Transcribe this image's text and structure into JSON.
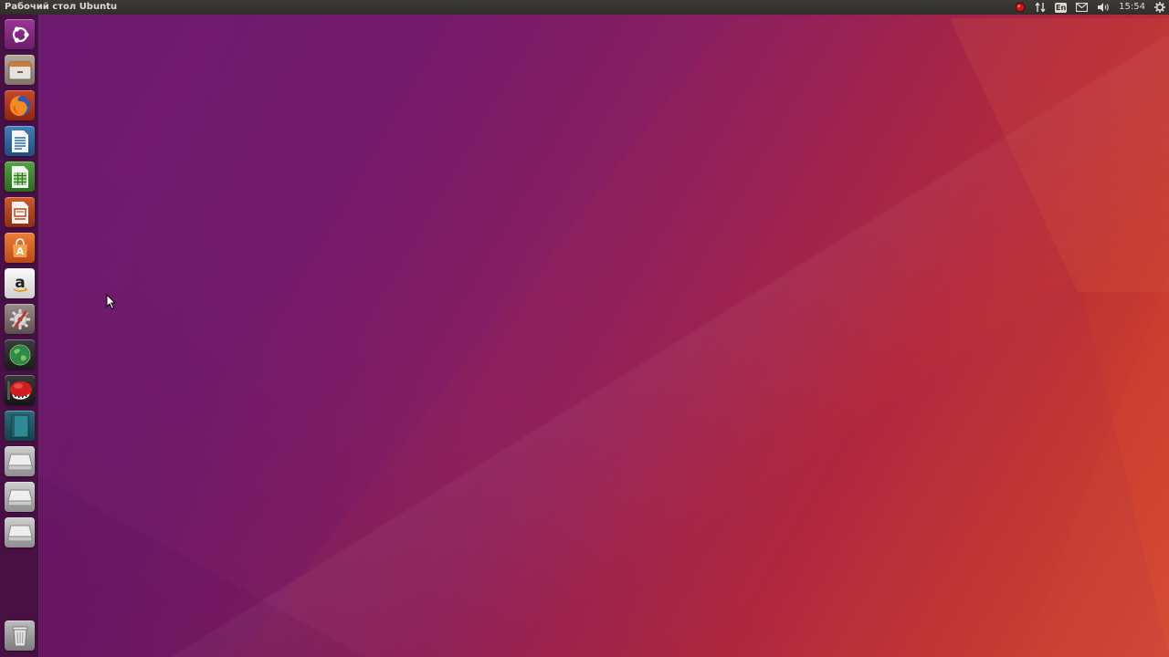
{
  "top_panel": {
    "title": "Рабочий стол Ubuntu",
    "keyboard_layout": "En",
    "clock": "15:54"
  },
  "launcher": {
    "items": [
      {
        "name": "dash-home",
        "icon": "ubuntu-logo-icon",
        "color": "#8e2a8a"
      },
      {
        "name": "files",
        "icon": "file-cabinet-icon",
        "color": "#9b8a7a"
      },
      {
        "name": "firefox",
        "icon": "firefox-icon",
        "color": "#b93a1f"
      },
      {
        "name": "writer",
        "icon": "document-icon",
        "color": "#2f6ea8"
      },
      {
        "name": "calc",
        "icon": "spreadsheet-icon",
        "color": "#3f8f2f"
      },
      {
        "name": "impress",
        "icon": "presentation-icon",
        "color": "#c2471f"
      },
      {
        "name": "software",
        "icon": "shopping-bag-icon",
        "color": "#e06a2a"
      },
      {
        "name": "amazon",
        "icon": "amazon-icon",
        "color": "#e8e8e8"
      },
      {
        "name": "settings",
        "icon": "wrench-gear-icon",
        "color": "#7a6b6b"
      },
      {
        "name": "browser-globe",
        "icon": "globe-icon",
        "color": "#2b6b3a"
      },
      {
        "name": "video-app",
        "icon": "red-mascot-icon",
        "color": "#b51717"
      },
      {
        "name": "notebook",
        "icon": "book-icon",
        "color": "#2f7a86"
      },
      {
        "name": "drive-1",
        "icon": "drive-icon",
        "color": "#cfcfcf"
      },
      {
        "name": "drive-2",
        "icon": "drive-icon",
        "color": "#cfcfcf"
      },
      {
        "name": "drive-3",
        "icon": "drive-icon",
        "color": "#cfcfcf"
      },
      {
        "name": "trash",
        "icon": "trash-icon",
        "color": "#bdbdbd"
      }
    ]
  },
  "colors": {
    "panel_bg": "#3c3b37",
    "panel_text": "#dfdbd2",
    "wallpaper_left": "#6a1a6e",
    "wallpaper_right": "#d64d35"
  }
}
